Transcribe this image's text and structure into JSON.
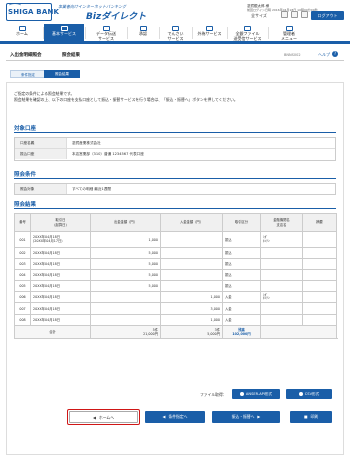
{
  "header": {
    "logo_text": "SHIGA BANK",
    "tagline": "事業者向けインターネットバンキング",
    "brand_small": "しがぎんBiz",
    "brand_big": "Bizダイレクト",
    "user_name": "滋賀銀太郎 様",
    "last_login": "前回ログイン日時 2016年04月18日 10時00分00秒",
    "all_services": "全サイズ",
    "logout": "ログアウト"
  },
  "nav": [
    {
      "label": "ホーム",
      "icon": "house-icon"
    },
    {
      "label": "基本サービス",
      "icon": "magnifier-icon",
      "active": true
    },
    {
      "label": "データ伝送\nサービス",
      "icon": "document-icon"
    },
    {
      "label": "承認",
      "icon": "pen-icon"
    },
    {
      "label": "でんさい\nサービス",
      "icon": "coin-icon"
    },
    {
      "label": "外為サービス",
      "icon": "globe-icon"
    },
    {
      "label": "全銀ファイル\n送受信サービス",
      "icon": "file-icon"
    },
    {
      "label": "管理者\nメニュー",
      "icon": "gear-icon"
    }
  ],
  "page": {
    "title_a": "入出金明細照会",
    "title_b": "照会結果",
    "screen_id": "BNNS002",
    "help": "ヘルプ",
    "help_icon": "?"
  },
  "steps": [
    "条件指定",
    "照会結果"
  ],
  "message": [
    "ご指定の条件による照会結果です。",
    "照会結果を確認の上、以下の口座を支払口座として振込・振替サービスを行う場合は、「振込・振替へ」ボタンを押してください。"
  ],
  "account": {
    "heading": "対象口座",
    "rows": [
      {
        "label": "口座名義",
        "value": "滋賀産業株式会社"
      },
      {
        "label": "振込口座",
        "value": "本店営業部（310）普通 1234567 代表口座"
      }
    ]
  },
  "conditions": {
    "heading": "照会条件",
    "rows": [
      {
        "label": "照会対象",
        "value": "すべての明細 最近1週間"
      }
    ]
  },
  "results": {
    "heading": "照会結果",
    "columns": [
      "番号",
      "取引日\n(起算日)",
      "出金金額（円）",
      "入金金額（円）",
      "取引区分",
      "金融機関名\n支店名",
      "摘要"
    ],
    "rows": [
      {
        "no": "001",
        "date": "20XX年04月18日\n(20XX年04月17日)",
        "out": "1,000",
        "in": "",
        "type": "振込",
        "bank": "ｼｶﾞ\nﾎﾝﾃﾝ",
        "memo": ""
      },
      {
        "no": "002",
        "date": "20XX年04月18日",
        "out": "5,000",
        "in": "",
        "type": "振込",
        "bank": "",
        "memo": ""
      },
      {
        "no": "003",
        "date": "20XX年04月18日",
        "out": "5,000",
        "in": "",
        "type": "振込",
        "bank": "",
        "memo": ""
      },
      {
        "no": "004",
        "date": "20XX年04月18日",
        "out": "5,000",
        "in": "",
        "type": "振込",
        "bank": "",
        "memo": ""
      },
      {
        "no": "005",
        "date": "20XX年04月18日",
        "out": "5,000",
        "in": "",
        "type": "振込",
        "bank": "",
        "memo": ""
      },
      {
        "no": "006",
        "date": "20XX年04月18日",
        "out": "",
        "in": "1,000",
        "type": "入金",
        "bank": "ｼｶﾞ\nﾎﾝﾃﾝ",
        "memo": ""
      },
      {
        "no": "007",
        "date": "20XX年04月18日",
        "out": "",
        "in": "3,000",
        "type": "入金",
        "bank": "",
        "memo": ""
      },
      {
        "no": "008",
        "date": "20XX年04月18日",
        "out": "",
        "in": "1,000",
        "type": "入金",
        "bank": "",
        "memo": ""
      }
    ],
    "total": {
      "label": "合計",
      "out_count": "5件",
      "out_amount": "21,000円",
      "in_count": "3件",
      "in_amount": "5,000円",
      "balance_label": "残高",
      "balance": "102,000円"
    }
  },
  "file": {
    "label": "ファイル取得：",
    "anser": "ANSER-API形式",
    "csv": "CSV形式"
  },
  "buttons": {
    "home": "ホームへ",
    "conditions": "条件指定へ",
    "transfer": "振込・振替へ",
    "print": "印刷"
  },
  "colors": {
    "primary": "#1a5ea8",
    "highlight": "#d01616"
  }
}
